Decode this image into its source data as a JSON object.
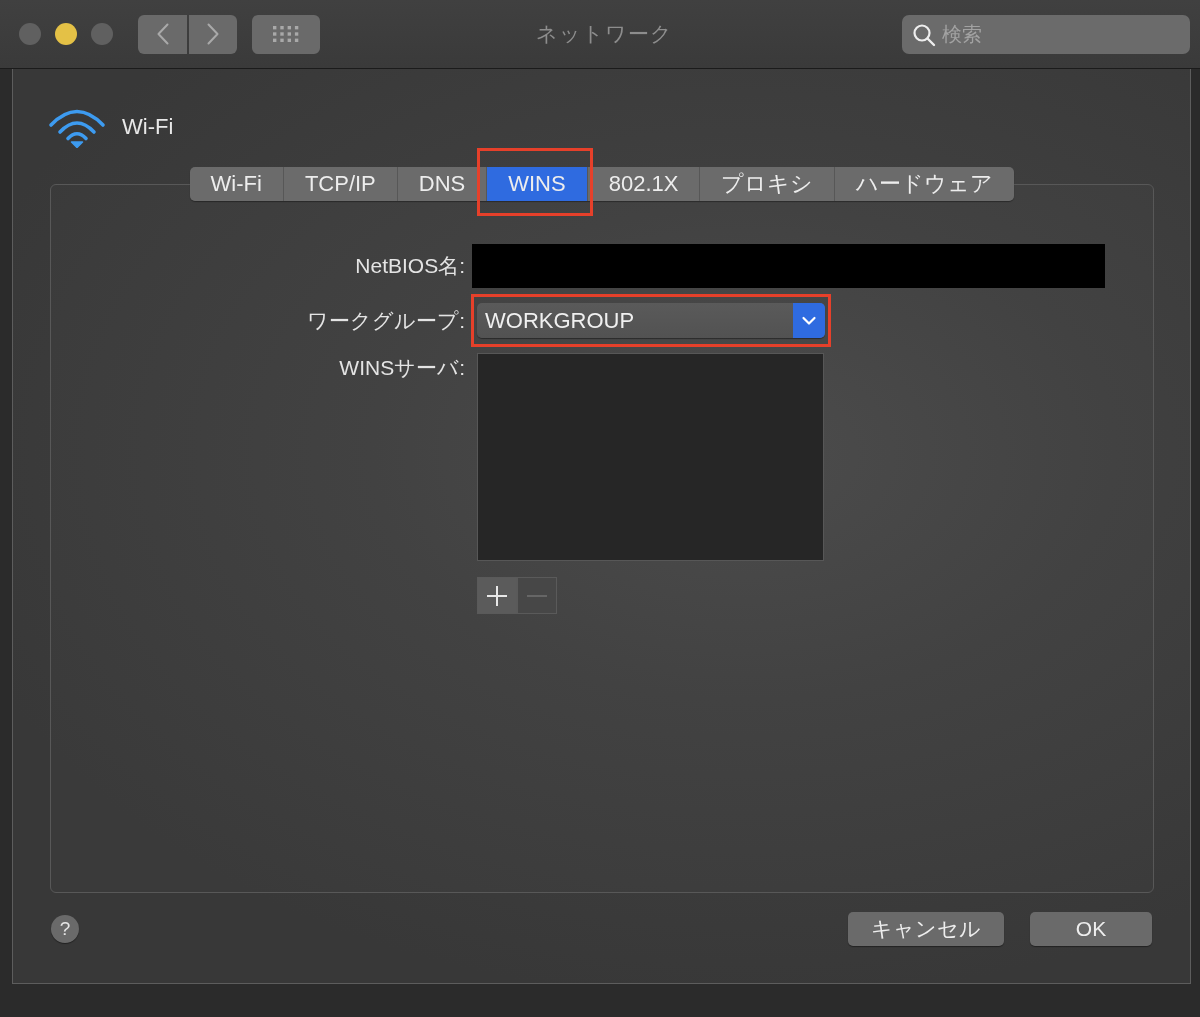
{
  "window": {
    "title": "ネットワーク",
    "traffic_lights": [
      {
        "color": "#606060"
      },
      {
        "color": "#e4c146"
      },
      {
        "color": "#606060"
      }
    ]
  },
  "toolbar": {
    "search": {
      "placeholder": "検索"
    }
  },
  "service": {
    "name": "Wi-Fi"
  },
  "tabs": [
    {
      "label": "Wi-Fi",
      "selected": false,
      "highlighted": false
    },
    {
      "label": "TCP/IP",
      "selected": false,
      "highlighted": false
    },
    {
      "label": "DNS",
      "selected": false,
      "highlighted": false
    },
    {
      "label": "WINS",
      "selected": true,
      "highlighted": true
    },
    {
      "label": "802.1X",
      "selected": false,
      "highlighted": false
    },
    {
      "label": "プロキシ",
      "selected": false,
      "highlighted": false
    },
    {
      "label": "ハードウェア",
      "selected": false,
      "highlighted": false
    }
  ],
  "form": {
    "netbios": {
      "label": "NetBIOS名:",
      "redacted": true
    },
    "workgroup": {
      "label": "ワークグループ:",
      "value": "WORKGROUP",
      "highlighted": true
    },
    "wins_servers": {
      "label": "WINSサーバ:",
      "add_disabled": false,
      "remove_disabled": true
    }
  },
  "footer": {
    "help": "?",
    "buttons": [
      {
        "label": "キャンセル"
      },
      {
        "label": "OK"
      }
    ]
  }
}
